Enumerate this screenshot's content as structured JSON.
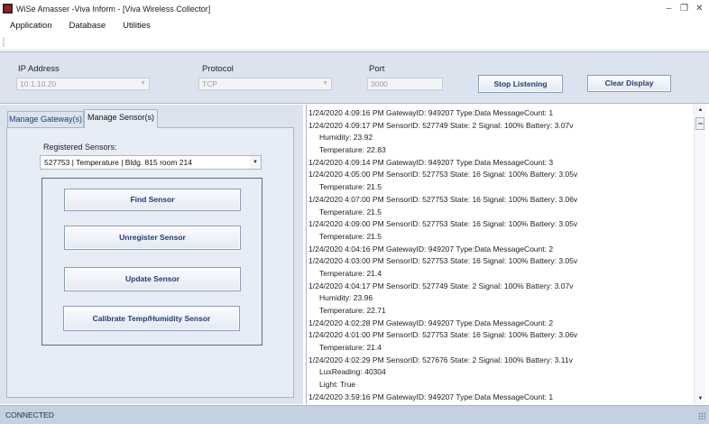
{
  "window": {
    "title": "WiSe Amasser -Viva Inform - [Viva Wireless Collector]",
    "minimize": "–",
    "restore": "❐",
    "close": "✕"
  },
  "menu": [
    "Application",
    "Database",
    "Utilities"
  ],
  "connection": {
    "ip_label": "IP Address",
    "ip_value": "10.1.10.20",
    "protocol_label": "Protocol",
    "protocol_value": "TCP",
    "port_label": "Port",
    "port_value": "3000",
    "stop_button": "Stop Listening",
    "clear_button": "Clear Display"
  },
  "tabs": [
    "Manage Gateway(s)",
    "Manage Sensor(s)"
  ],
  "sensors": {
    "label": "Registered Sensors:",
    "selected": "527753 | Temperature | Bldg. 815 room 214",
    "buttons": [
      "Find Sensor",
      "Unregister Sensor",
      "Update Sensor",
      "Calibrate Temp/Humidity Sensor"
    ]
  },
  "log": [
    {
      "text": "1/24/2020 4:09:16 PM GatewayID: 949207 Type:Data MessageCount: 1",
      "indent": false
    },
    {
      "text": "1/24/2020 4:09:17 PM SensorID: 527749 State: 2 Signal: 100% Battery: 3.07v",
      "indent": false
    },
    {
      "text": "Humidity: 23.92",
      "indent": true
    },
    {
      "text": "Temperature: 22.83",
      "indent": true
    },
    {
      "text": "1/24/2020 4:09:14 PM GatewayID: 949207 Type:Data MessageCount: 3",
      "indent": false
    },
    {
      "text": "1/24/2020 4:05:00 PM SensorID: 527753 State: 16 Signal: 100% Battery: 3.05v",
      "indent": false
    },
    {
      "text": "Temperature: 21.5",
      "indent": true
    },
    {
      "text": "1/24/2020 4:07:00 PM SensorID: 527753 State: 16 Signal: 100% Battery: 3.06v",
      "indent": false
    },
    {
      "text": "Temperature: 21.5",
      "indent": true
    },
    {
      "text": "1/24/2020 4:09:00 PM SensorID: 527753 State: 16 Signal: 100% Battery: 3.05v",
      "indent": false
    },
    {
      "text": "Temperature: 21.5",
      "indent": true
    },
    {
      "text": "1/24/2020 4:04:16 PM GatewayID: 949207 Type:Data MessageCount: 2",
      "indent": false
    },
    {
      "text": "1/24/2020 4:03:00 PM SensorID: 527753 State: 16 Signal: 100% Battery: 3.05v",
      "indent": false
    },
    {
      "text": "Temperature: 21.4",
      "indent": true
    },
    {
      "text": "1/24/2020 4:04:17 PM SensorID: 527749 State: 2 Signal: 100% Battery: 3.07v",
      "indent": false
    },
    {
      "text": "Humidity: 23.96",
      "indent": true
    },
    {
      "text": "Temperature: 22.71",
      "indent": true
    },
    {
      "text": "1/24/2020 4:02:28 PM GatewayID: 949207 Type:Data MessageCount: 2",
      "indent": false
    },
    {
      "text": "1/24/2020 4:01:00 PM SensorID: 527753 State: 16 Signal: 100% Battery: 3.06v",
      "indent": false
    },
    {
      "text": "Temperature: 21.4",
      "indent": true
    },
    {
      "text": "1/24/2020 4:02:29 PM SensorID: 527676 State: 2 Signal: 100% Battery: 3.11v",
      "indent": false
    },
    {
      "text": "LuxReading: 40304",
      "indent": true
    },
    {
      "text": "Light: True",
      "indent": true
    },
    {
      "text": "1/24/2020 3:59:16 PM GatewayID: 949207 Type:Data MessageCount: 1",
      "indent": false
    }
  ],
  "status": "CONNECTED",
  "colors": {
    "panel": "#dbe3ef",
    "tab_panel": "#e7edf6",
    "button_text": "#1f3d73",
    "statusbar": "#c4d1e3"
  }
}
